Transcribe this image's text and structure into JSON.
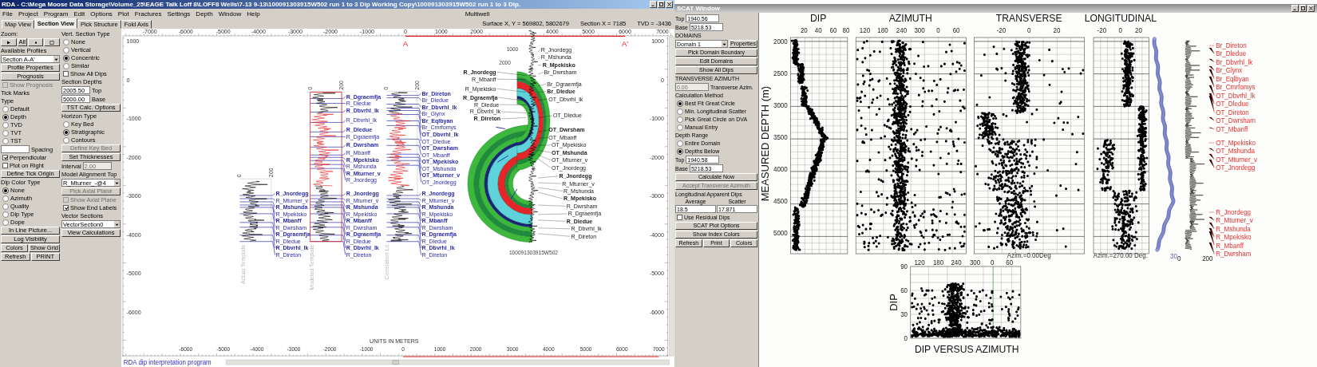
{
  "section_window": {
    "title": "RDA - C:\\Mega Moose Data Storage\\Volume_25\\EAGE Talk Loff 8\\LOFF8 Wells\\7-13 9-13\\100091303915W502 run 1 to 3 Dip Working Copy\\100091303915W502 run 1 to 3 Dip.",
    "menu": [
      "File",
      "Project",
      "Program",
      "Edit",
      "Options",
      "Plot",
      "Fractures",
      "Settings",
      "Depth",
      "Window",
      "Help"
    ],
    "menu_label": "Multiwell",
    "tabs": [
      {
        "label": "Map View",
        "selected": false
      },
      {
        "label": "Section View",
        "selected": true
      },
      {
        "label": "Pick Structure",
        "selected": false
      },
      {
        "label": "Fold Axis",
        "selected": false
      }
    ],
    "readouts": [
      "Surface X, Y = 569802, 5802679",
      "Section X = 7185",
      "TVD = -3436"
    ],
    "controls_left": [
      {
        "kind": "heading",
        "text": "Zoom:"
      },
      {
        "kind": "zoom",
        "label": "All"
      },
      {
        "kind": "heading",
        "text": "Available Profiles"
      },
      {
        "kind": "select",
        "value": "Section A-A'"
      },
      {
        "kind": "button",
        "text": "Profile Properties",
        "disabled": false
      },
      {
        "kind": "button",
        "text": "Prognosis",
        "disabled": false
      },
      {
        "kind": "check",
        "text": "Show Prognosis",
        "checked": false,
        "disabled": true
      },
      {
        "kind": "heading",
        "text": "Tick Marks"
      },
      {
        "kind": "heading",
        "text": "Type"
      },
      {
        "kind": "radio",
        "text": "Default",
        "selected": false
      },
      {
        "kind": "radio",
        "text": "Depth",
        "selected": true
      },
      {
        "kind": "radio",
        "text": "TVD",
        "selected": false
      },
      {
        "kind": "radio",
        "text": "TVT",
        "selected": false
      },
      {
        "kind": "radio",
        "text": "TST",
        "selected": false
      },
      {
        "kind": "blank_field",
        "label": "Spacing"
      },
      {
        "kind": "check",
        "text": "Perpendicular",
        "checked": true,
        "disabled": false
      },
      {
        "kind": "check",
        "text": "Plot on Right",
        "checked": false,
        "disabled": false
      },
      {
        "kind": "button",
        "text": "Define Tick Origin",
        "disabled": false
      },
      {
        "kind": "heading",
        "text": "Dip Color Type"
      },
      {
        "kind": "radio",
        "text": "None",
        "selected": true
      },
      {
        "kind": "radio",
        "text": "Azimuth",
        "selected": false
      },
      {
        "kind": "radio",
        "text": "Quality",
        "selected": false
      },
      {
        "kind": "radio",
        "text": "Dip Type",
        "selected": false
      },
      {
        "kind": "radio",
        "text": "Dope",
        "selected": false
      },
      {
        "kind": "button",
        "text": "In Line Picture...",
        "disabled": false
      },
      {
        "kind": "button",
        "text": "Log Visibility",
        "disabled": false
      },
      {
        "kind": "buttons",
        "texts": [
          "Colors",
          "Show Grid"
        ]
      },
      {
        "kind": "buttons",
        "texts": [
          "Refresh",
          "PRINT"
        ]
      }
    ],
    "controls_right": [
      {
        "kind": "heading",
        "text": "Vert. Section Type"
      },
      {
        "kind": "radio",
        "text": "None",
        "selected": false
      },
      {
        "kind": "radio",
        "text": "Vertical",
        "selected": false
      },
      {
        "kind": "radio",
        "text": "Concentric",
        "selected": true
      },
      {
        "kind": "radio",
        "text": "Similar",
        "selected": false
      },
      {
        "kind": "check",
        "text": "Show All Dips",
        "checked": false,
        "disabled": false
      },
      {
        "kind": "heading",
        "text": "Section Depths"
      },
      {
        "kind": "field",
        "value": "2005.50",
        "label": "Top",
        "disabled": false
      },
      {
        "kind": "field",
        "value": "5000.00",
        "label": "Base",
        "disabled": false
      },
      {
        "kind": "button",
        "text": "TST Calc. Options",
        "disabled": false
      },
      {
        "kind": "heading",
        "text": "Horizon Type"
      },
      {
        "kind": "radio",
        "text": "Key Bed",
        "selected": false
      },
      {
        "kind": "radio",
        "text": "Stratigraphic",
        "selected": true
      },
      {
        "kind": "radio",
        "text": "Contours",
        "selected": false
      },
      {
        "kind": "button",
        "text": "Define Key Bed",
        "disabled": true
      },
      {
        "kind": "button",
        "text": "Set Thicknesses",
        "disabled": false
      },
      {
        "kind": "labeled_field",
        "label": "Interval",
        "value": "2.00",
        "disabled": true
      },
      {
        "kind": "heading",
        "text": "Model Alignment Top"
      },
      {
        "kind": "select",
        "value": "R_Mturner_-@4"
      },
      {
        "kind": "button",
        "text": "Pick Axial Plane",
        "disabled": true
      },
      {
        "kind": "check",
        "text": "Show Axial Plane",
        "checked": false,
        "disabled": true
      },
      {
        "kind": "check",
        "text": "Show End Labels",
        "checked": true,
        "disabled": false
      },
      {
        "kind": "heading",
        "text": "Vector Sections"
      },
      {
        "kind": "select",
        "value": "VectorSection0"
      },
      {
        "kind": "button",
        "text": "View Calculations",
        "disabled": false
      }
    ],
    "canvas": {
      "top_ruler": [
        "-7000",
        "-6000",
        "-5000",
        "-4000",
        "-3000",
        "-2000",
        "-1000",
        "0",
        "1000",
        "2000",
        "4000",
        "5000",
        "6000",
        "7000"
      ],
      "section_markers": [
        "A",
        "A'"
      ],
      "left_ruler": [
        "1000",
        "0",
        "-1000",
        "-2000",
        "-3000",
        "-4000",
        "-5000",
        "-6000"
      ],
      "right_ruler": [
        "1000",
        "0",
        "-1000",
        "-2000",
        "-3000",
        "-4000",
        "-5000",
        "-6000"
      ],
      "tracks": [
        {
          "kind": "actual",
          "caption": "Actual Template",
          "scale": [
            "0",
            "200"
          ],
          "labels": [
            "R_Jnordegg",
            "R_Mturner_v",
            "R_Mshunda",
            "R_Mpekisko",
            "R_Mbanff",
            "R_Dwrsham",
            "R_Dgraemfja",
            "R_Dledue",
            "R_Dbvrhl_lk",
            "R_Direton"
          ]
        },
        {
          "kind": "modeled",
          "caption": "Modeled Template",
          "scale": [
            "0",
            "200"
          ],
          "labels": [
            "R_Dgraemfja",
            "R_Dledue",
            "R_Dbvrhl_lk",
            "R_Dbvrhl_lk",
            "R_Dledue",
            "R_Dgraemfja",
            "R_Dwrsham",
            "R_Mbanff",
            "R_Mpekisko",
            "R_Mshunda",
            "R_Mturner_v",
            "R_Jnordegg",
            "R_Jnordegg",
            "R_Mturner_v",
            "R_Mshunda",
            "R_Mpekisko",
            "R_Mbanff",
            "R_Dwrsham",
            "R_Dgraemfja",
            "R_Dledue",
            "R_Dbvrhl_lk",
            "R_Direton"
          ]
        },
        {
          "kind": "correlation",
          "caption": "Correlation Lo",
          "scale": [
            "0",
            "200"
          ],
          "labels": [
            "Br_Direton",
            "Br_Dledue",
            "Br_Dbvrhl_lk",
            "Br_Glynx",
            "Br_Eqlbyan",
            "Br_Cmrfomys",
            "OT_Dbvrhl_lk",
            "OT_Dledue",
            "OT_Dwrsham",
            "OT_Mbanff",
            "OT_Mpekisko",
            "OT_Mshunda",
            "OT_Mturner_v",
            "OT_Jnordegg",
            "R_Jnordegg",
            "R_Mturner_v",
            "R_Mshunda",
            "R_Mpekisko",
            "R_Mbanff",
            "R_Dwrsham",
            "R_Dgraemfja",
            "R_Dledue",
            "R_Dbvrhl_lk",
            "R_Direton"
          ]
        }
      ],
      "fan": {
        "depths": [
          "1000",
          "2000"
        ],
        "well": "100091303915W502",
        "labels": [
          "R_Jnordegg",
          "R_Mbanff",
          "R_Mpekisko",
          "R_Dgraemfja",
          "R_Dledue",
          "R_Dbvrhl_lk",
          "R_Direton",
          "R_Jnordegg",
          "R_Mshunda",
          "R_Mpekisko",
          "Br_Dwrsham",
          "Br_Dgraemfja",
          "Br_Dledue",
          "OT_Dbvrhl_lk",
          "OT_Dledue",
          "OT_Dwrsham",
          "OT_Mbanff",
          "OT_Mpekisko",
          "OT_Mshunda",
          "OT_Mturner_v",
          "OT_Jnordegg",
          "R_Jnordegg",
          "R_Mturner_v",
          "R_Mshunda",
          "R_Mpekisko",
          "R_Dwrsham",
          "R_Dgraemfja",
          "R_Dledue",
          "R_Dbvrhl_lk",
          "R_Direton"
        ]
      },
      "bottom_ruler": {
        "title": "UNITS IN METERS",
        "labels": [
          "-6000",
          "-5000",
          "-4000",
          "-3000",
          "-2000",
          "-1000",
          "0",
          "1000",
          "2000",
          "3000",
          "4000",
          "5000",
          "6000",
          "7000"
        ]
      },
      "caption": "RDA dip interpretation program"
    }
  },
  "scat_window": {
    "title": "SCAT Window",
    "controls": [
      {
        "kind": "labeled_field",
        "label": "Top",
        "value": "1940.56",
        "disabled": false
      },
      {
        "kind": "labeled_field",
        "label": "Base",
        "value": "5218.53",
        "disabled": false
      },
      {
        "kind": "heading",
        "text": "DOMAINS"
      },
      {
        "kind": "select_button",
        "value": "Domain 1",
        "button": "Properties"
      },
      {
        "kind": "button",
        "text": "Pick Domain Boundary",
        "disabled": false
      },
      {
        "kind": "button",
        "text": "Edit Domains",
        "disabled": false
      },
      {
        "kind": "button",
        "text": "Show All Dips",
        "disabled": false
      },
      {
        "kind": "heading",
        "text": "TRANSVERSE AZIMUTH"
      },
      {
        "kind": "field",
        "value": "0.00",
        "label": "Transverse Azim.",
        "disabled": true
      },
      {
        "kind": "heading",
        "text": "Calculation Method"
      },
      {
        "kind": "radio",
        "text": "Best Fit Great Circle",
        "selected": true
      },
      {
        "kind": "radio",
        "text": "Min. Longitudinal Scatter",
        "selected": false
      },
      {
        "kind": "radio",
        "text": "Pick Great Circle on DVA",
        "selected": false
      },
      {
        "kind": "radio",
        "text": "Manual Entry",
        "selected": false
      },
      {
        "kind": "heading",
        "text": "Depth Range"
      },
      {
        "kind": "radio",
        "text": "Entire Domain",
        "selected": false
      },
      {
        "kind": "radio",
        "text": "Depths Below",
        "selected": true
      },
      {
        "kind": "labeled_field",
        "label": "Top",
        "value": "1940.58",
        "disabled": false
      },
      {
        "kind": "labeled_field",
        "label": "Base",
        "value": "5218.53",
        "disabled": false
      },
      {
        "kind": "button",
        "text": "Calculate Now",
        "disabled": false
      },
      {
        "kind": "button",
        "text": "Accept Transverse Azimuth",
        "disabled": true
      },
      {
        "kind": "heading",
        "text": "Longitudinal Apparent Dips"
      },
      {
        "kind": "labels",
        "texts": [
          "Average",
          "Scatter"
        ]
      },
      {
        "kind": "fields",
        "values": [
          "18.5",
          "17.871"
        ]
      },
      {
        "kind": "check",
        "text": "Use Residual Dips",
        "checked": false,
        "disabled": false
      },
      {
        "kind": "button",
        "text": "SCAT Plot Options",
        "disabled": false
      },
      {
        "kind": "button",
        "text": "Show Index Colors",
        "disabled": false
      },
      {
        "kind": "buttons",
        "texts": [
          "Refresh",
          "Print",
          "Colors"
        ]
      }
    ],
    "charts": {
      "y_title": "MEASURED DEPTH (m)",
      "depth_ticks": [
        "2000",
        "2500",
        "3000",
        "3500",
        "4000",
        "4500",
        "5000"
      ],
      "tracks": [
        {
          "kind": "dip",
          "title": "DIP",
          "ticks": [
            "20",
            "40",
            "60",
            "80"
          ]
        },
        {
          "kind": "azimuth",
          "title": "AZIMUTH",
          "ticks": [
            "120",
            "180",
            "240",
            "300",
            "0",
            "60"
          ]
        },
        {
          "kind": "transverse",
          "title": "TRANSVERSE",
          "ticks": [
            "-20",
            "0",
            "20"
          ],
          "note": "Azim.=0.00Deg"
        },
        {
          "kind": "longitudinal",
          "title": "LONGITUDINAL",
          "ticks": [
            "-20",
            "0",
            "20"
          ],
          "note": "Azim.=270.00 Deg."
        }
      ],
      "curve_scale": "30",
      "log_ticks": [
        "0",
        "200"
      ],
      "formations": [
        "Br_Direton",
        "Br_Dledue",
        "Br_Dbvrhl_lk",
        "Br_Glynx",
        "Br_Eqlbyan",
        "Br_Cmrfomys",
        "OT_Dbvrhl_lk",
        "OT_Dledue",
        "OT_Direton",
        "OT_Dwrsham",
        "OT_Mbanff",
        "OT_Mpekisko",
        "OT_Mshunda",
        "OT_Mturner_v",
        "OT_Jnordegg",
        "R_Jnordegg",
        "R_Mturner_v",
        "R_Mshunda",
        "R_Mpekisko",
        "R_Mbanff",
        "R_Dwrsham"
      ],
      "dip_vs_azimuth": {
        "title": "DIP VERSUS AZIMUTH",
        "ylabel": "DIP",
        "xticks": [
          "120",
          "180",
          "240",
          "300",
          "0",
          "60"
        ],
        "yticks": [
          "90",
          "60",
          "30",
          "0"
        ]
      }
    }
  }
}
